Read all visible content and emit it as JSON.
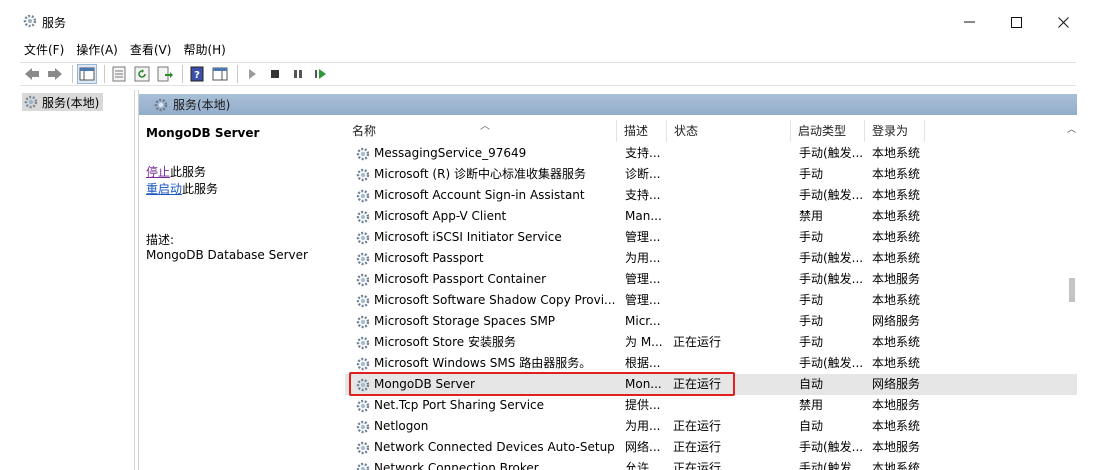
{
  "window": {
    "title": "服务",
    "minimize": "—",
    "maximize": "☐",
    "close": "✕"
  },
  "menu": [
    "文件(F)",
    "操作(A)",
    "查看(V)",
    "帮助(H)"
  ],
  "tree": {
    "item": "服务(本地)"
  },
  "pane": {
    "header": "服务(本地)"
  },
  "detail": {
    "title": "MongoDB Server",
    "stop_link": "停止",
    "stop_suffix": "此服务",
    "restart_link": "重启动",
    "restart_suffix": "此服务",
    "desc_label": "描述:",
    "desc_value": "MongoDB Database Server"
  },
  "columns": {
    "name": "名称",
    "desc": "描述",
    "status": "状态",
    "startup": "启动类型",
    "logon": "登录为"
  },
  "services": [
    {
      "name": "MessagingService_97649",
      "desc": "支持...",
      "status": "",
      "startup": "手动(触发...",
      "logon": "本地系统"
    },
    {
      "name": "Microsoft (R) 诊断中心标准收集器服务",
      "desc": "诊断...",
      "status": "",
      "startup": "手动",
      "logon": "本地系统"
    },
    {
      "name": "Microsoft Account Sign-in Assistant",
      "desc": "支持...",
      "status": "",
      "startup": "手动(触发...",
      "logon": "本地系统"
    },
    {
      "name": "Microsoft App-V Client",
      "desc": "Man...",
      "status": "",
      "startup": "禁用",
      "logon": "本地系统"
    },
    {
      "name": "Microsoft iSCSI Initiator Service",
      "desc": "管理...",
      "status": "",
      "startup": "手动",
      "logon": "本地系统"
    },
    {
      "name": "Microsoft Passport",
      "desc": "为用...",
      "status": "",
      "startup": "手动(触发...",
      "logon": "本地系统"
    },
    {
      "name": "Microsoft Passport Container",
      "desc": "管理...",
      "status": "",
      "startup": "手动(触发...",
      "logon": "本地服务"
    },
    {
      "name": "Microsoft Software Shadow Copy Provi...",
      "desc": "管理...",
      "status": "",
      "startup": "手动",
      "logon": "本地系统"
    },
    {
      "name": "Microsoft Storage Spaces SMP",
      "desc": "Micr...",
      "status": "",
      "startup": "手动",
      "logon": "网络服务"
    },
    {
      "name": "Microsoft Store 安装服务",
      "desc": "为 M...",
      "status": "正在运行",
      "startup": "手动",
      "logon": "本地系统"
    },
    {
      "name": "Microsoft Windows SMS 路由器服务。",
      "desc": "根据...",
      "status": "",
      "startup": "手动(触发...",
      "logon": "本地系统"
    },
    {
      "name": "MongoDB Server",
      "desc": "Mon...",
      "status": "正在运行",
      "startup": "自动",
      "logon": "网络服务"
    },
    {
      "name": "Net.Tcp Port Sharing Service",
      "desc": "提供...",
      "status": "",
      "startup": "禁用",
      "logon": "本地服务"
    },
    {
      "name": "Netlogon",
      "desc": "为用...",
      "status": "正在运行",
      "startup": "自动",
      "logon": "本地系统"
    },
    {
      "name": "Network Connected Devices Auto-Setup",
      "desc": "网络...",
      "status": "正在运行",
      "startup": "手动(触发...",
      "logon": "本地服务"
    },
    {
      "name": "Network Connection Broker",
      "desc": "允许...",
      "status": "正在运行",
      "startup": "手动(触发...",
      "logon": "本地系统"
    }
  ],
  "selected_service": "MongoDB Server",
  "colors": {
    "header_blue": "#a9bfd8",
    "link": "#1a55c6",
    "highlight": "#e02020"
  }
}
